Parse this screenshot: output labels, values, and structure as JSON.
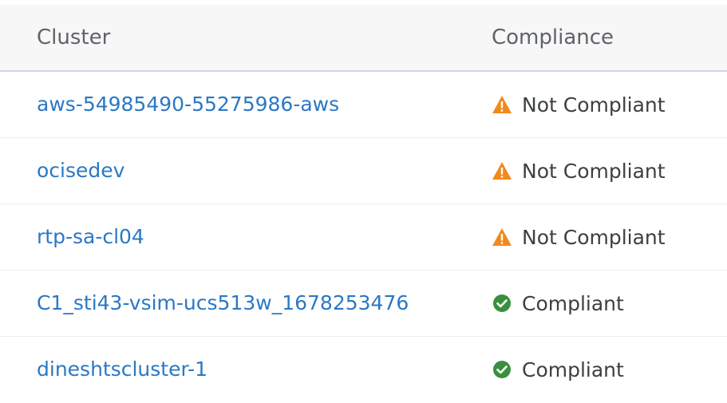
{
  "table": {
    "columns": {
      "cluster": "Cluster",
      "compliance": "Compliance"
    },
    "rows": [
      {
        "cluster": "aws-54985490-55275986-aws",
        "status": "Not Compliant",
        "icon": "warning-icon"
      },
      {
        "cluster": "ocisedev",
        "status": "Not Compliant",
        "icon": "warning-icon"
      },
      {
        "cluster": "rtp-sa-cl04",
        "status": "Not Compliant",
        "icon": "warning-icon"
      },
      {
        "cluster": "C1_sti43-vsim-ucs513w_1678253476",
        "status": "Compliant",
        "icon": "check-circle-icon"
      },
      {
        "cluster": "dineshtscluster-1",
        "status": "Compliant",
        "icon": "check-circle-icon"
      }
    ]
  },
  "colors": {
    "link": "#2b78c5",
    "warning": "#f08a1c",
    "success": "#3a8f3f",
    "header_bg": "#f7f7f8"
  }
}
